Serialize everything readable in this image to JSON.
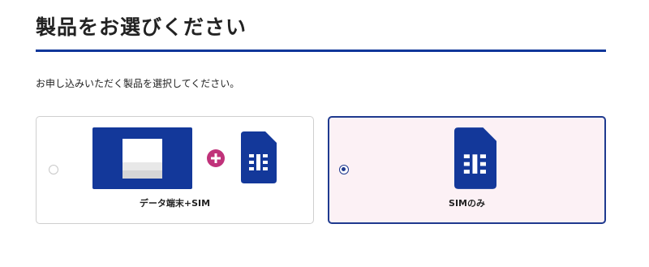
{
  "header": {
    "title": "製品をお選びください"
  },
  "instruction": "お申し込みいただく製品を選択してください。",
  "options": [
    {
      "label": "データ端末+SIM",
      "selected": false,
      "icons": [
        "device-icon",
        "plus-icon",
        "sim-card-icon"
      ]
    },
    {
      "label": "SIMのみ",
      "selected": true,
      "icons": [
        "sim-card-icon"
      ]
    }
  ],
  "colors": {
    "accent": "#10369a",
    "icon_blue": "#13389a",
    "plus_magenta": "#c0327a",
    "selected_bg": "#fcf1f5",
    "selected_border": "#1f3a8f",
    "unselected_border": "#cfcfcf"
  }
}
